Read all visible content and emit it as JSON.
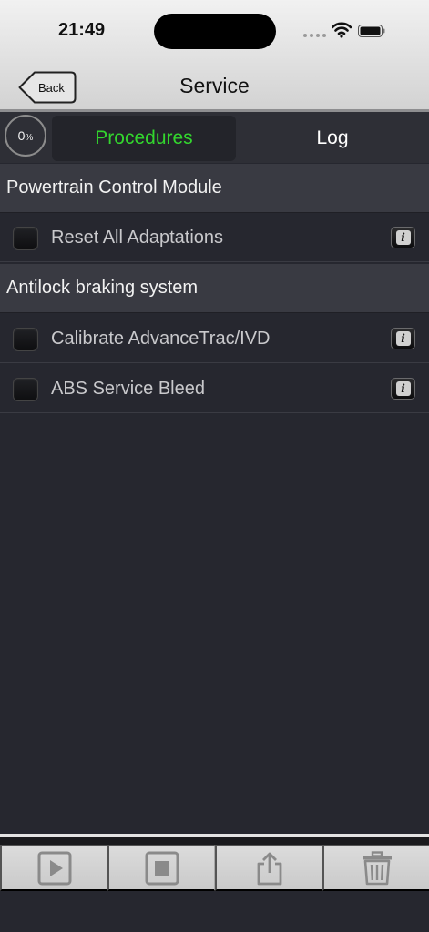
{
  "status_bar": {
    "time": "21:49"
  },
  "nav": {
    "title": "Service",
    "back_label": "Back"
  },
  "progress": {
    "value": "0",
    "unit": "%"
  },
  "tabs": [
    {
      "label": "Procedures",
      "selected": true
    },
    {
      "label": "Log",
      "selected": false
    }
  ],
  "sections": [
    {
      "header": "Powertrain Control Module",
      "items": [
        {
          "label": "Reset All Adaptations"
        }
      ]
    },
    {
      "header": "Antilock braking system",
      "items": [
        {
          "label": "Calibrate AdvanceTrac/IVD"
        },
        {
          "label": "ABS Service Bleed"
        }
      ]
    }
  ],
  "toolbar": {
    "buttons": [
      {
        "icon": "play-icon"
      },
      {
        "icon": "stop-icon"
      },
      {
        "icon": "share-icon"
      },
      {
        "icon": "trash-icon"
      }
    ]
  },
  "colors": {
    "accent_selected_tab": "#33d62e",
    "background": "#26272f",
    "section_header": "#393a42"
  }
}
